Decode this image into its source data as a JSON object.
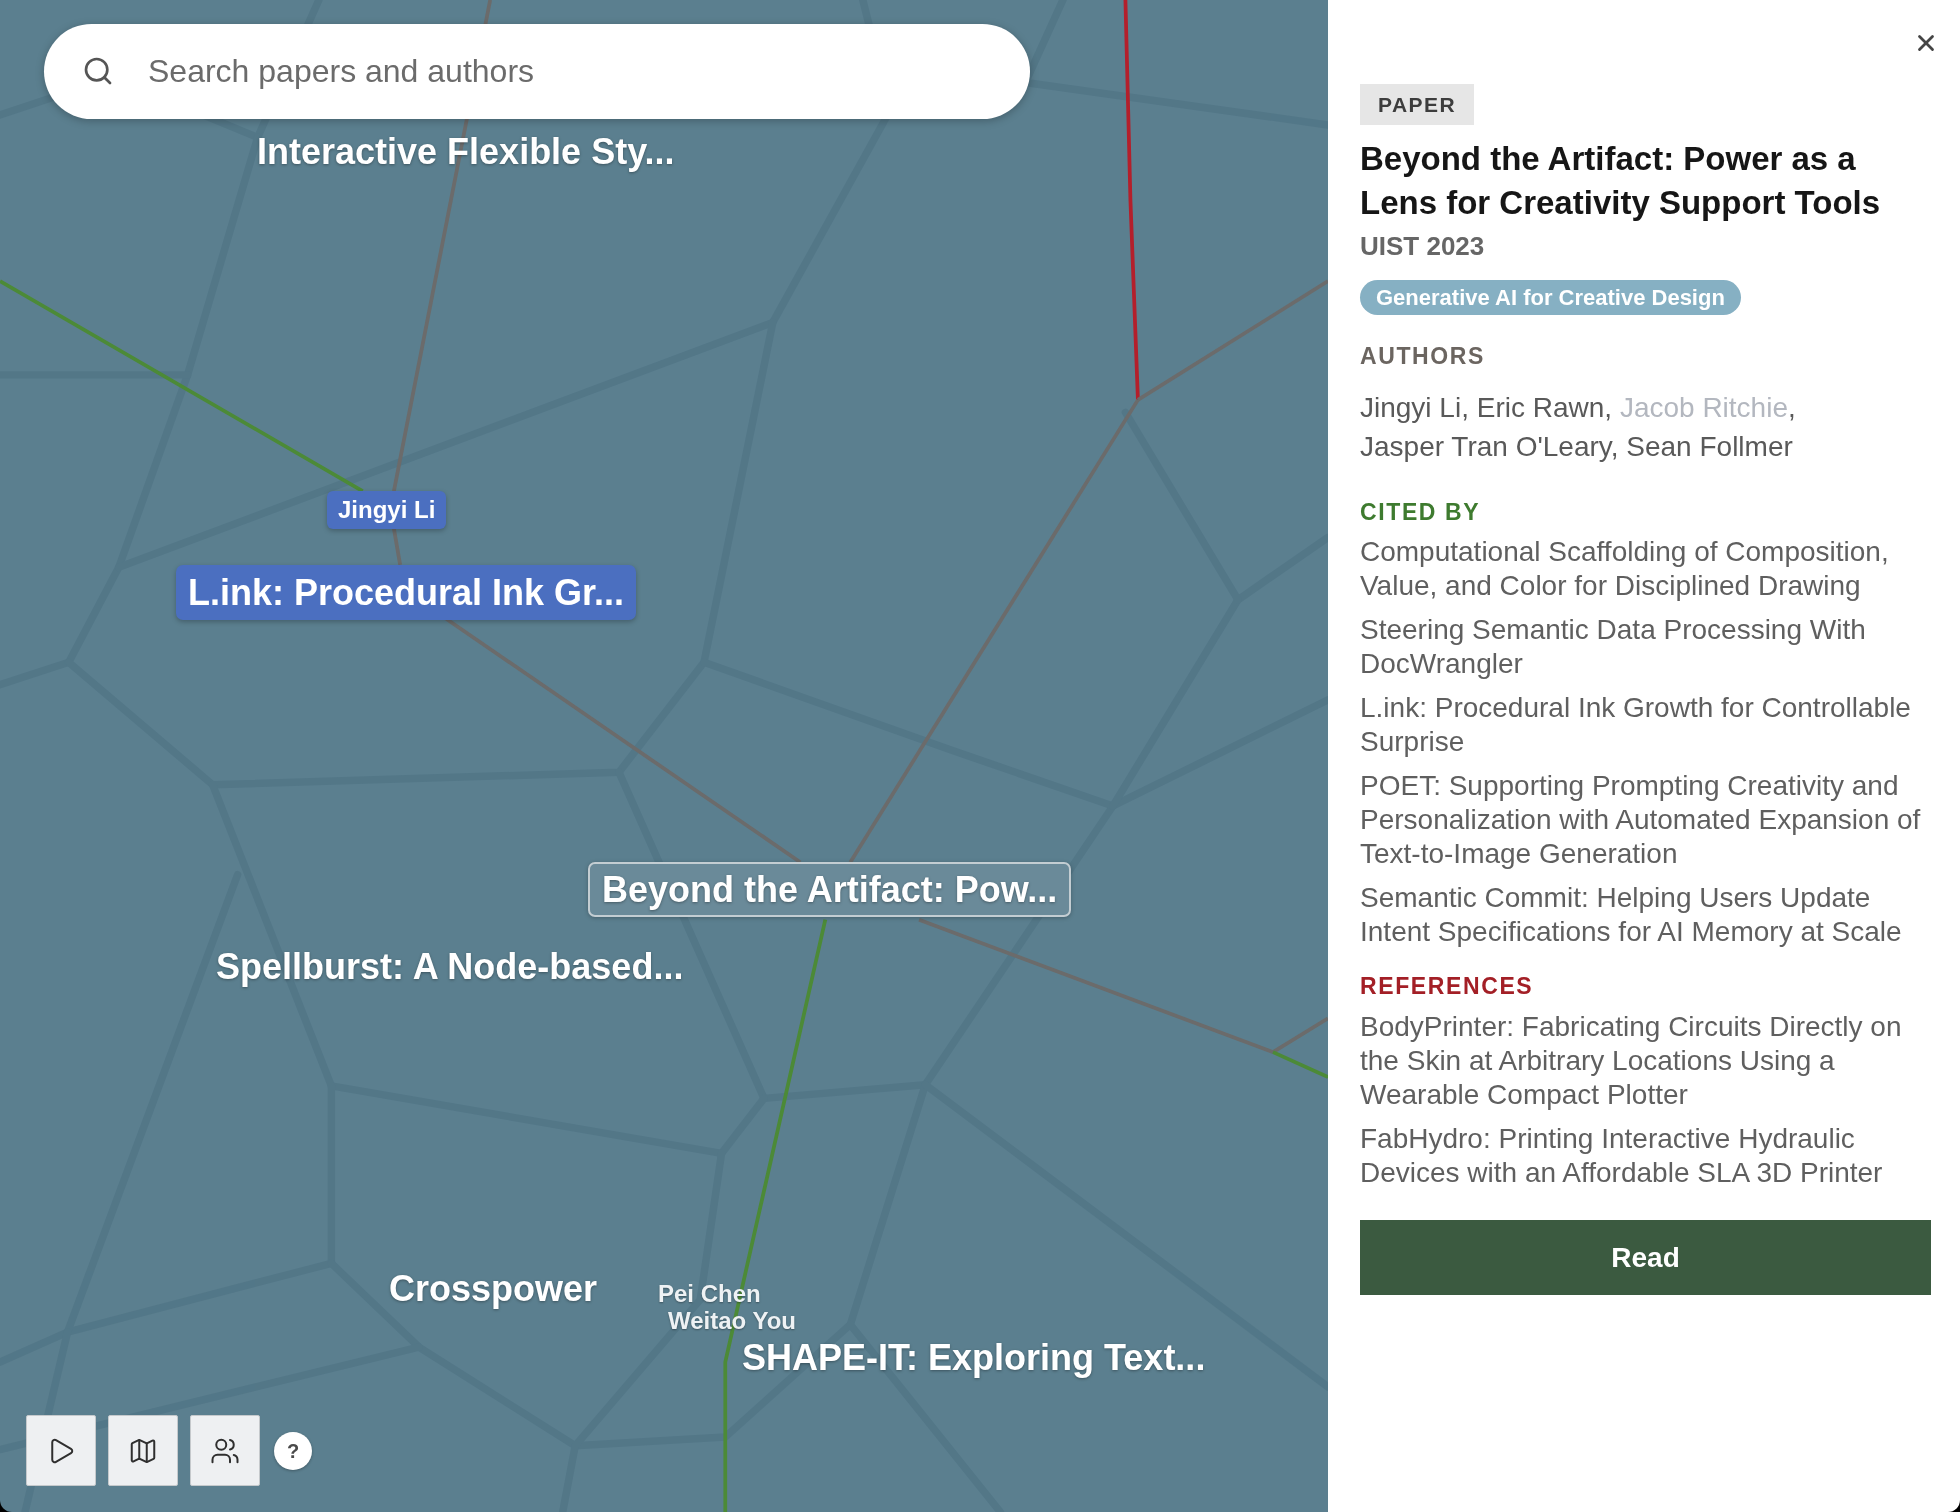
{
  "map": {
    "search": {
      "placeholder": "Search papers and authors"
    },
    "labels": [
      {
        "kind": "paper",
        "text": "Interactive Flexible Sty...",
        "selected": false,
        "highlighted": false
      },
      {
        "kind": "author",
        "text": "Jingyi Li",
        "selected": false,
        "highlighted": true
      },
      {
        "kind": "paper",
        "text": "L.ink: Procedural Ink Gr...",
        "selected": false,
        "highlighted": true
      },
      {
        "kind": "paper",
        "text": "Beyond the Artifact: Pow...",
        "selected": true,
        "highlighted": false
      },
      {
        "kind": "paper",
        "text": "Spellburst: A Node-based...",
        "selected": false,
        "highlighted": false
      },
      {
        "kind": "paper",
        "text": "Crosspower",
        "selected": false,
        "highlighted": false
      },
      {
        "kind": "author",
        "text": "Pei Chen",
        "selected": false,
        "highlighted": false
      },
      {
        "kind": "author",
        "text": "Weitao You",
        "selected": false,
        "highlighted": false
      },
      {
        "kind": "paper",
        "text": "SHAPE-IT: Exploring Text...",
        "selected": false,
        "highlighted": false
      }
    ],
    "controls": [
      {
        "kind": "play"
      },
      {
        "kind": "map"
      },
      {
        "kind": "people"
      },
      {
        "kind": "help",
        "label": "?"
      }
    ]
  },
  "panel": {
    "type_badge": "PAPER",
    "title": "Beyond the Artifact: Power as a Lens for Creativity Support Tools",
    "venue": "UIST 2023",
    "topic": "Generative AI for Creative Design",
    "authors_heading": "AUTHORS",
    "author_separator": ",",
    "authors": [
      {
        "name": "Jingyi Li",
        "muted": false
      },
      {
        "name": "Eric Rawn",
        "muted": false
      },
      {
        "name": "Jacob Ritchie",
        "muted": true
      },
      {
        "name": "Jasper Tran O'Leary",
        "muted": false
      },
      {
        "name": "Sean Follmer",
        "muted": false
      }
    ],
    "cited_by_heading": "CITED BY",
    "cited_by": [
      "Computational Scaffolding of Composition, Value, and Color for Disciplined Drawing",
      "Steering Semantic Data Processing With DocWrangler",
      "L.ink: Procedural Ink Growth for Controllable Surprise",
      "POET: Supporting Prompting Creativity and Personalization with Automated Expansion of Text-to-Image Generation",
      "Semantic Commit: Helping Users Update Intent Specifications for AI Memory at Scale"
    ],
    "references_heading": "REFERENCES",
    "references": [
      "BodyPrinter: Fabricating Circuits Directly on the Skin at Arbitrary Locations Using a Wearable Compact Plotter",
      "FabHydro: Printing Interactive Hydraulic Devices with an Affordable SLA 3D Printer"
    ],
    "read_button": "Read"
  }
}
